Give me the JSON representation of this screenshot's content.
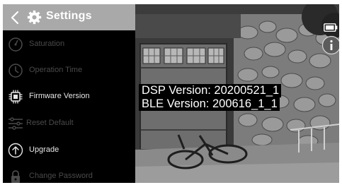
{
  "header": {
    "title": "Settings"
  },
  "menu": {
    "items": [
      {
        "label": "Saturation",
        "icon": "saturation-icon",
        "state": "disabled"
      },
      {
        "label": "Operation Time",
        "icon": "clock-icon",
        "state": "disabled"
      },
      {
        "label": "Firmware Version",
        "icon": "chip-icon",
        "state": "enabled"
      },
      {
        "label": "Reset Default",
        "icon": "sliders-icon",
        "state": "disabled"
      },
      {
        "label": "Upgrade",
        "icon": "upgrade-arrow-icon",
        "state": "enabled"
      },
      {
        "label": "Change Password",
        "icon": "lock-icon",
        "state": "disabled"
      }
    ]
  },
  "firmware": {
    "dsp_version": "DSP Version: 20200521_1",
    "ble_version": "BLE Version: 200616_1_1"
  },
  "status": {
    "battery_icon": "battery-icon",
    "info_icon": "info-icon"
  },
  "colors": {
    "header_bg": "#a9a9a9",
    "sidebar_bg": "#000000",
    "text_enabled": "#e6e6e6",
    "text_disabled": "#4a4a4a"
  }
}
